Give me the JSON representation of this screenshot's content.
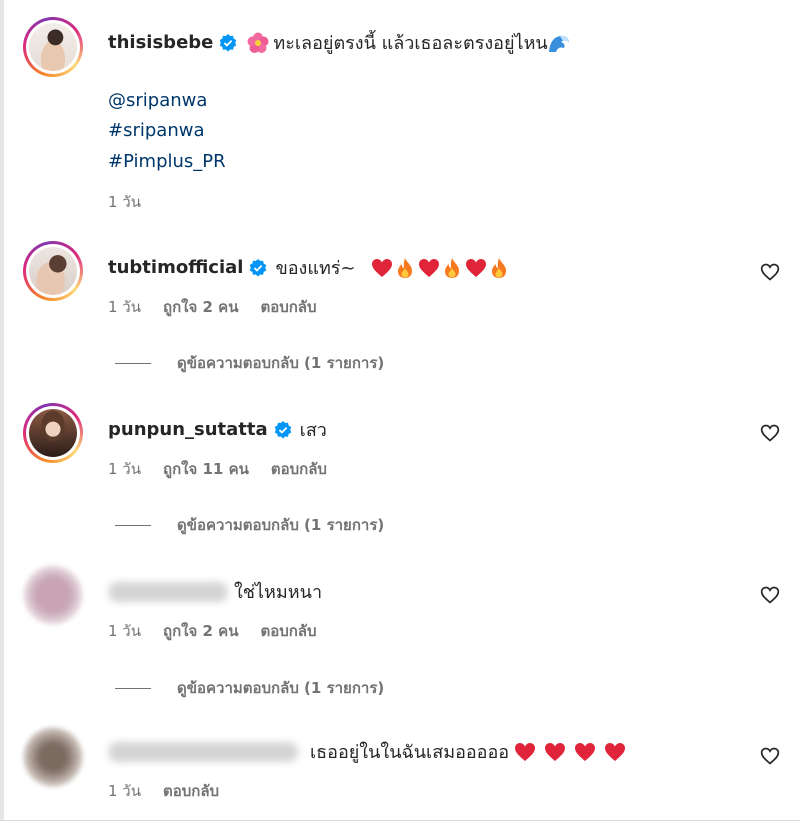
{
  "caption": {
    "username": "thisisbebe",
    "text": "ทะเลอยู่ตรงนี้ แล้วเธอละตรงอยู่ไหน",
    "mention": "@sripanwa",
    "hashtags": [
      "#sripanwa",
      "#Pimplus_PR"
    ],
    "time": "1 วัน"
  },
  "comments": [
    {
      "username": "tubtimofficial",
      "text": "ของแทร่~",
      "time": "1 วัน",
      "likes": "ถูกใจ 2 คน",
      "reply": "ตอบกลับ",
      "view_replies": "ดูข้อความตอบกลับ (1 รายการ)"
    },
    {
      "username": "punpun_sutatta",
      "text": "เสว",
      "time": "1 วัน",
      "likes": "ถูกใจ 11 คน",
      "reply": "ตอบกลับ",
      "view_replies": "ดูข้อความตอบกลับ (1 รายการ)"
    },
    {
      "text": "ใช่ไหมหนา",
      "time": "1 วัน",
      "likes": "ถูกใจ 2 คน",
      "reply": "ตอบกลับ",
      "view_replies": "ดูข้อความตอบกลับ (1 รายการ)"
    },
    {
      "text": "เธออยู่ในในฉันเสมอออออ",
      "time": "1 วัน",
      "reply": "ตอบกลับ"
    }
  ],
  "icons": {
    "verified": "verified-badge-icon",
    "like": "heart-outline-icon",
    "emoji_heart": "red-heart-emoji",
    "emoji_fire": "fire-emoji",
    "emoji_flower": "hibiscus-emoji",
    "emoji_wave": "wave-emoji"
  },
  "colors": {
    "link": "#00376b",
    "verified": "#0095f6",
    "meta": "#737373",
    "text": "#262626"
  }
}
